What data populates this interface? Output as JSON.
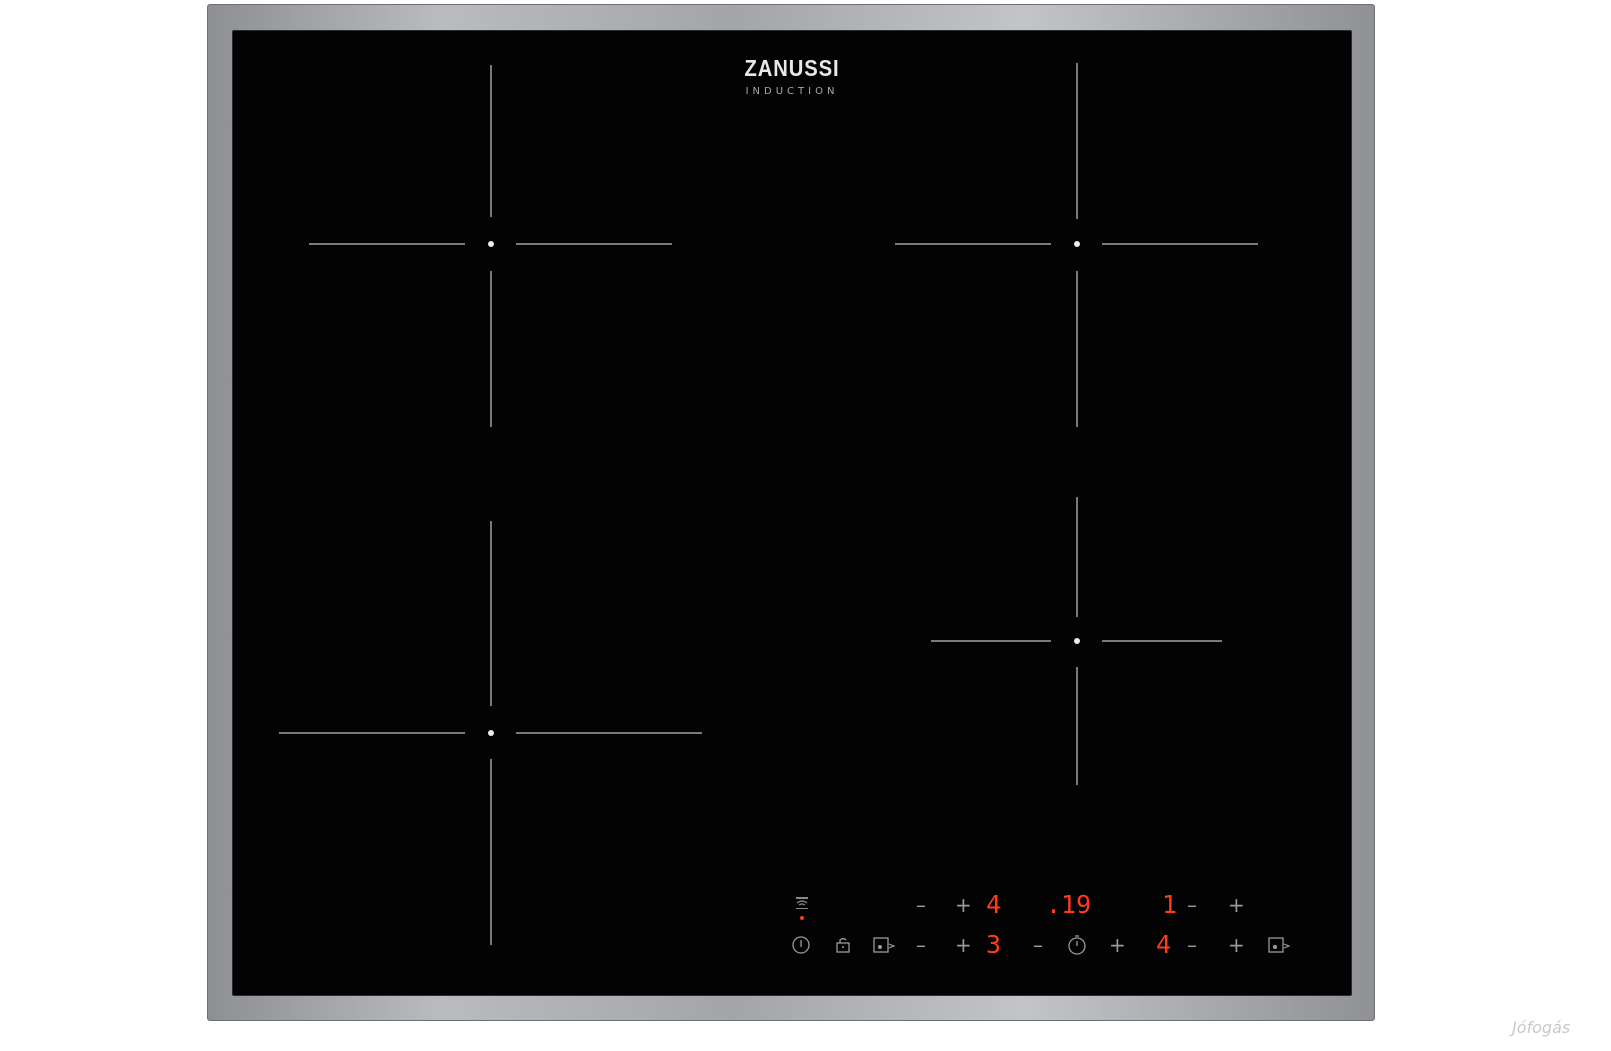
{
  "brand": {
    "name": "ZANUSSI",
    "subtitle": "INDUCTION"
  },
  "colors": {
    "glass": "#030303",
    "frame": "#a3a5a8",
    "display": "#ff3b1a",
    "marking": "#7a7a7a"
  },
  "controls": {
    "row1": {
      "minus_left": "–",
      "plus_left": "+",
      "display_left": "4",
      "display_timer": ".19",
      "display_right": "1",
      "minus_right": "–",
      "plus_right": "+"
    },
    "row2": {
      "minus_left": "–",
      "plus_left": "+",
      "display_left": "3",
      "timer_minus": "–",
      "timer_plus": "+",
      "display_right": "4",
      "minus_right": "–",
      "plus_right": "+"
    },
    "icons": [
      "hob-connect-icon",
      "power-icon",
      "lock-icon",
      "pause-icon",
      "timer-icon",
      "bridge-icon"
    ]
  },
  "watermark": "Jófogás"
}
